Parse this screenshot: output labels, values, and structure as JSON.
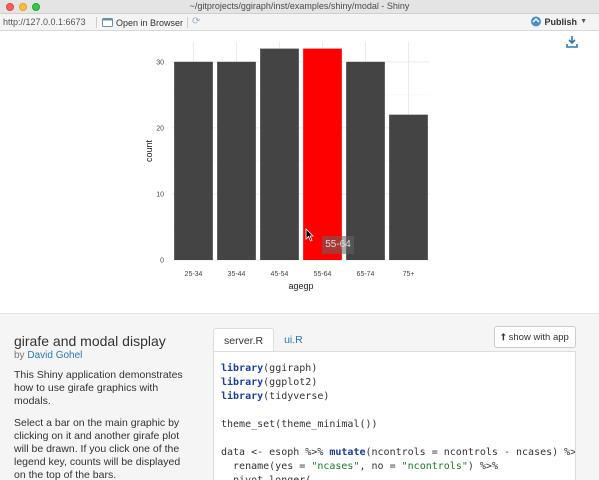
{
  "window": {
    "title": "~/gitprojects/ggiraph/inst/examples/shiny/modal - Shiny"
  },
  "toolbar": {
    "url": "http://127.0.0.1:6673",
    "open_browser": "Open in Browser",
    "publish": "Publish"
  },
  "chart_data": {
    "type": "bar",
    "categories": [
      "25-34",
      "35-44",
      "45-54",
      "55-64",
      "65-74",
      "75+"
    ],
    "values": [
      30,
      30,
      32,
      32,
      30,
      22
    ],
    "highlighted": "55-64",
    "colors": {
      "bar": "#454445",
      "highlight": "#ff0000"
    },
    "xlabel": "agegp",
    "ylabel": "count",
    "yticks": [
      0,
      10,
      20,
      30
    ],
    "ylim": [
      0,
      33
    ],
    "tooltip": "55-64",
    "grid": true
  },
  "app": {
    "title": "girafe and modal display",
    "by": "by",
    "author": "David Gohel",
    "desc1": "This Shiny application demonstrates how to use girafe graphics with modals.",
    "desc2": "Select a bar on the main graphic by clicking on it and another girafe plot will be drawn. If you click one of the legend key, counts will be displayed on the top of the bars."
  },
  "tabs": [
    {
      "label": "server.R",
      "active": true
    },
    {
      "label": "ui.R",
      "active": false
    }
  ],
  "show_with_app": "show with app",
  "code_lines": [
    [
      {
        "t": "library",
        "c": "kw"
      },
      {
        "t": "(ggiraph)"
      }
    ],
    [
      {
        "t": "library",
        "c": "kw"
      },
      {
        "t": "(ggplot2)"
      }
    ],
    [
      {
        "t": "library",
        "c": "kw"
      },
      {
        "t": "(tidyverse)"
      }
    ],
    [
      {
        "t": ""
      }
    ],
    [
      {
        "t": "theme_set(theme_minimal())"
      }
    ],
    [
      {
        "t": ""
      }
    ],
    [
      {
        "t": "data <- esoph %>% "
      },
      {
        "t": "mutate",
        "c": "kw"
      },
      {
        "t": "(ncontrols = ncontrols - ncases) %>%"
      }
    ],
    [
      {
        "t": "  rename(yes = "
      },
      {
        "t": "\"ncases\"",
        "c": "str"
      },
      {
        "t": ", no = "
      },
      {
        "t": "\"ncontrols\"",
        "c": "str"
      },
      {
        "t": ") %>%"
      }
    ],
    [
      {
        "t": "  pivot_longer("
      }
    ]
  ]
}
